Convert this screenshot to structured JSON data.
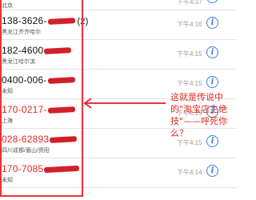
{
  "calls": [
    {
      "number": "",
      "location": "北京",
      "time": "下午4:37",
      "missed": false,
      "count": ""
    },
    {
      "number": "138-3626-",
      "location": "黑龙江齐齐哈尔",
      "time": "下午4:16",
      "missed": false,
      "count": "(2)"
    },
    {
      "number": "182-4600",
      "location": "黑龙江哈尔滨",
      "time": "下午4:15",
      "missed": false,
      "count": ""
    },
    {
      "number": "0400-006-",
      "location": "未知",
      "time": "下午4:15",
      "missed": false,
      "count": ""
    },
    {
      "number": "170-0217-",
      "location": "上海",
      "time": "下午4:15",
      "missed": true,
      "count": ""
    },
    {
      "number": "028-62893",
      "location": "四川成都/眉山/资阳",
      "time": "下午4:15",
      "missed": true,
      "count": ""
    },
    {
      "number": "170-7085",
      "location": "未知",
      "time": "下午4:14",
      "missed": true,
      "count": ""
    }
  ],
  "annotation": {
    "text": "这就是传说中的\"淘宝店主绝技\"——呼死你么？"
  },
  "colors": {
    "missed": "#e0281f",
    "info": "#3a7fe0",
    "highlight": "#e8323a"
  },
  "icons": {
    "info": "info-circle-icon"
  }
}
